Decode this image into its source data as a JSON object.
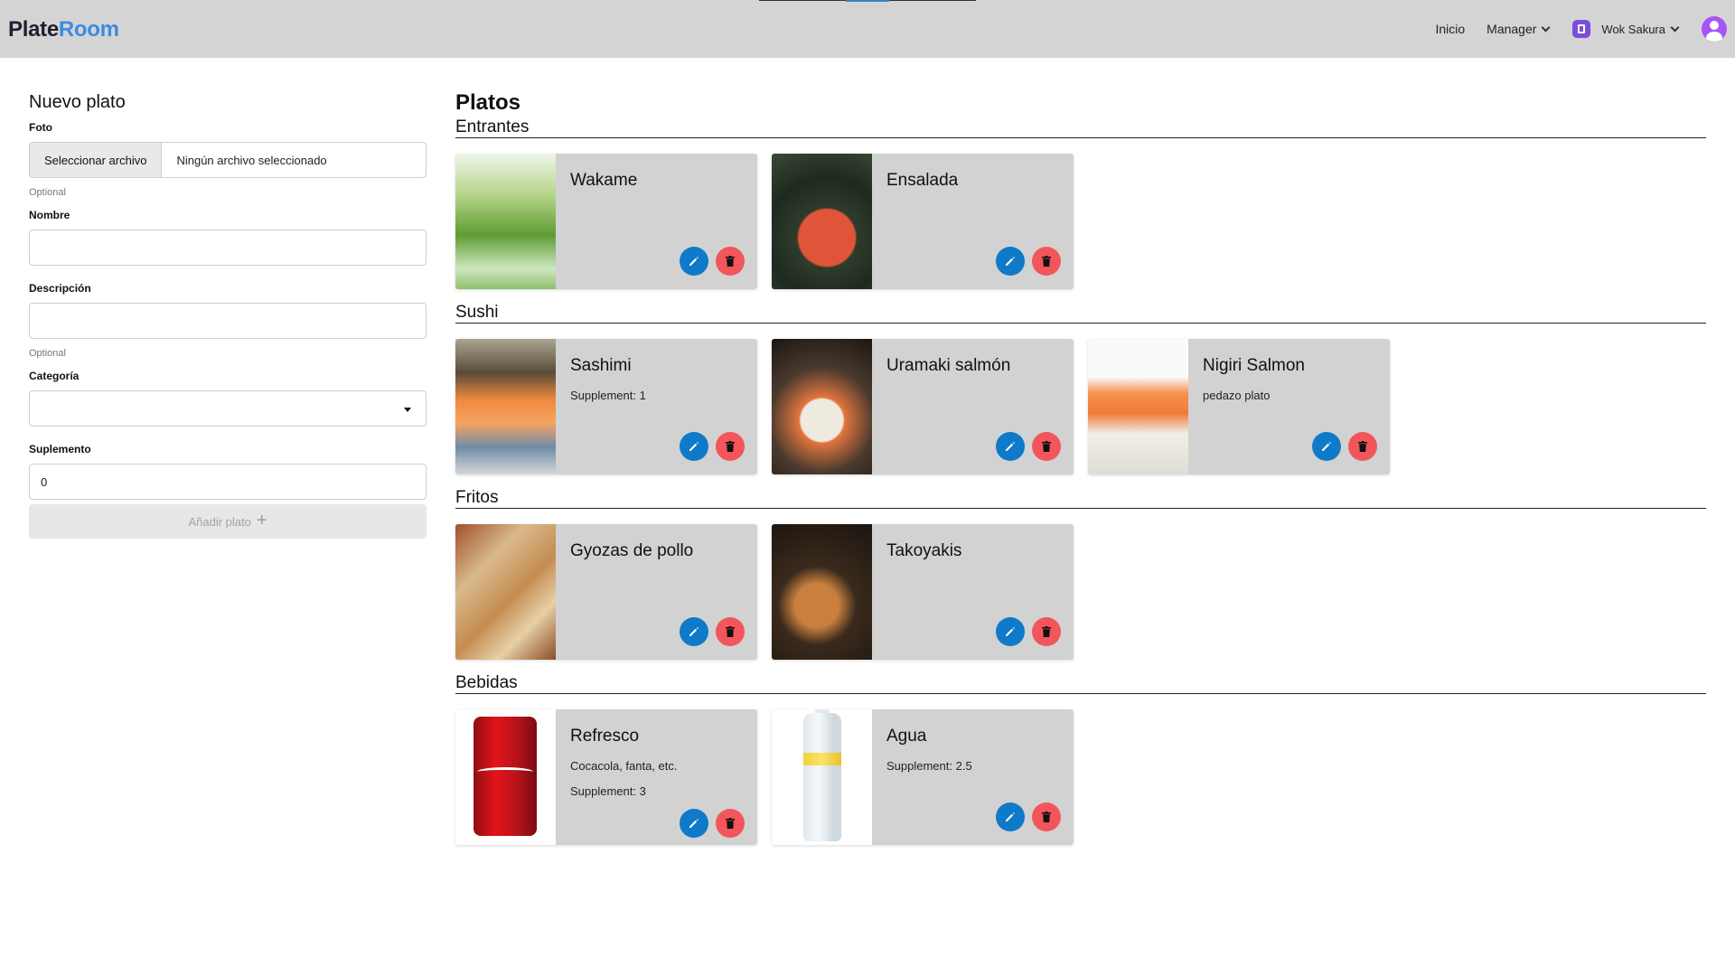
{
  "header": {
    "brand_part1": "Plate",
    "brand_part2": "Room",
    "nav": {
      "inicio": "Inicio",
      "manager": "Manager",
      "restaurant": "Wok Sakura"
    },
    "colors": {
      "bar": "#d4d4d4",
      "brand_accent": "#3d8be0",
      "avatar": "#a855f7",
      "restaurant_badge": "#7c4ddb"
    }
  },
  "form": {
    "title": "Nuevo plato",
    "foto_label": "Foto",
    "file_button": "Seleccionar archivo",
    "file_status": "Ningún archivo seleccionado",
    "foto_hint": "Optional",
    "nombre_label": "Nombre",
    "nombre_value": "",
    "descripcion_label": "Descripción",
    "descripcion_value": "",
    "descripcion_hint": "Optional",
    "categoria_label": "Categoría",
    "categoria_value": "",
    "suplemento_label": "Suplemento",
    "suplemento_value": "0",
    "submit_label": "Añadir plato",
    "submit_icon": "+"
  },
  "main": {
    "title": "Platos",
    "categories": [
      {
        "name": "Entrantes",
        "dishes": [
          {
            "name": "Wakame",
            "lines": [],
            "image": "wakame-photo"
          },
          {
            "name": "Ensalada",
            "lines": [],
            "image": "ensalada-photo"
          }
        ]
      },
      {
        "name": "Sushi",
        "dishes": [
          {
            "name": "Sashimi",
            "lines": [
              "Supplement: 1"
            ],
            "image": "sashimi-photo"
          },
          {
            "name": "Uramaki salmón",
            "lines": [],
            "image": "uramaki-photo"
          },
          {
            "name": "Nigiri Salmon",
            "lines": [
              "pedazo plato"
            ],
            "image": "nigiri-photo"
          }
        ]
      },
      {
        "name": "Fritos",
        "dishes": [
          {
            "name": "Gyozas de pollo",
            "lines": [],
            "image": "gyoza-photo"
          },
          {
            "name": "Takoyakis",
            "lines": [],
            "image": "takoyaki-photo"
          }
        ]
      },
      {
        "name": "Bebidas",
        "dishes": [
          {
            "name": "Refresco",
            "lines": [
              "Cocacola, fanta, etc.",
              "Supplement: 3"
            ],
            "image": "refresco-photo"
          },
          {
            "name": "Agua",
            "lines": [
              "Supplement: 2.5"
            ],
            "image": "agua-photo"
          }
        ]
      }
    ],
    "action_icons": {
      "edit": "pencil-icon",
      "delete": "trash-icon"
    },
    "colors": {
      "card": "#d2d2d2",
      "edit_button": "#0e7ac9",
      "delete_button": "#f2565a"
    }
  }
}
